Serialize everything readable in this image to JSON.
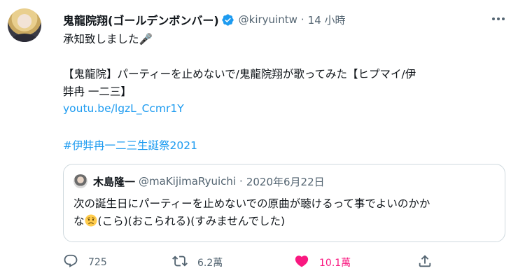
{
  "tweet": {
    "author": {
      "display_name": "鬼龍院翔(ゴールデンボンバー)",
      "handle": "@kiryuintw",
      "verified": true
    },
    "separator": "·",
    "time": "14 小時",
    "body": {
      "line1": "承知致しました🎤",
      "line2": "【鬼龍院】パーティーを止めないで/鬼龍院翔が歌ってみた【ヒプマイ/伊",
      "line3": "弉冉 一二三】",
      "link": "youtu.be/lgzL_Ccmr1Y",
      "hashtag": "#伊弉冉一二三生誕祭2021"
    },
    "quote": {
      "author": {
        "display_name": "木島隆一",
        "handle": "@maKijimaRyuichi"
      },
      "separator": "·",
      "date": "2020年6月22日",
      "line1": "次の誕生日にパーティーを止めないでの原曲が聴けるって事でよいのかか",
      "line2_prefix": "な",
      "line2_emoji": "worried-face",
      "line2_suffix": "(こら)(おこられる)(すみませんでした)"
    },
    "actions": {
      "reply_count": "725",
      "retweet_count": "6.2萬",
      "like_count": "10.1萬"
    },
    "colors": {
      "link": "#1d9bf0",
      "secondary_text": "#536471",
      "like": "#f91880",
      "border": "#cfd9de"
    },
    "icons": [
      "more-icon",
      "verified-icon",
      "reply-icon",
      "retweet-icon",
      "like-heart-icon",
      "share-icon"
    ]
  }
}
